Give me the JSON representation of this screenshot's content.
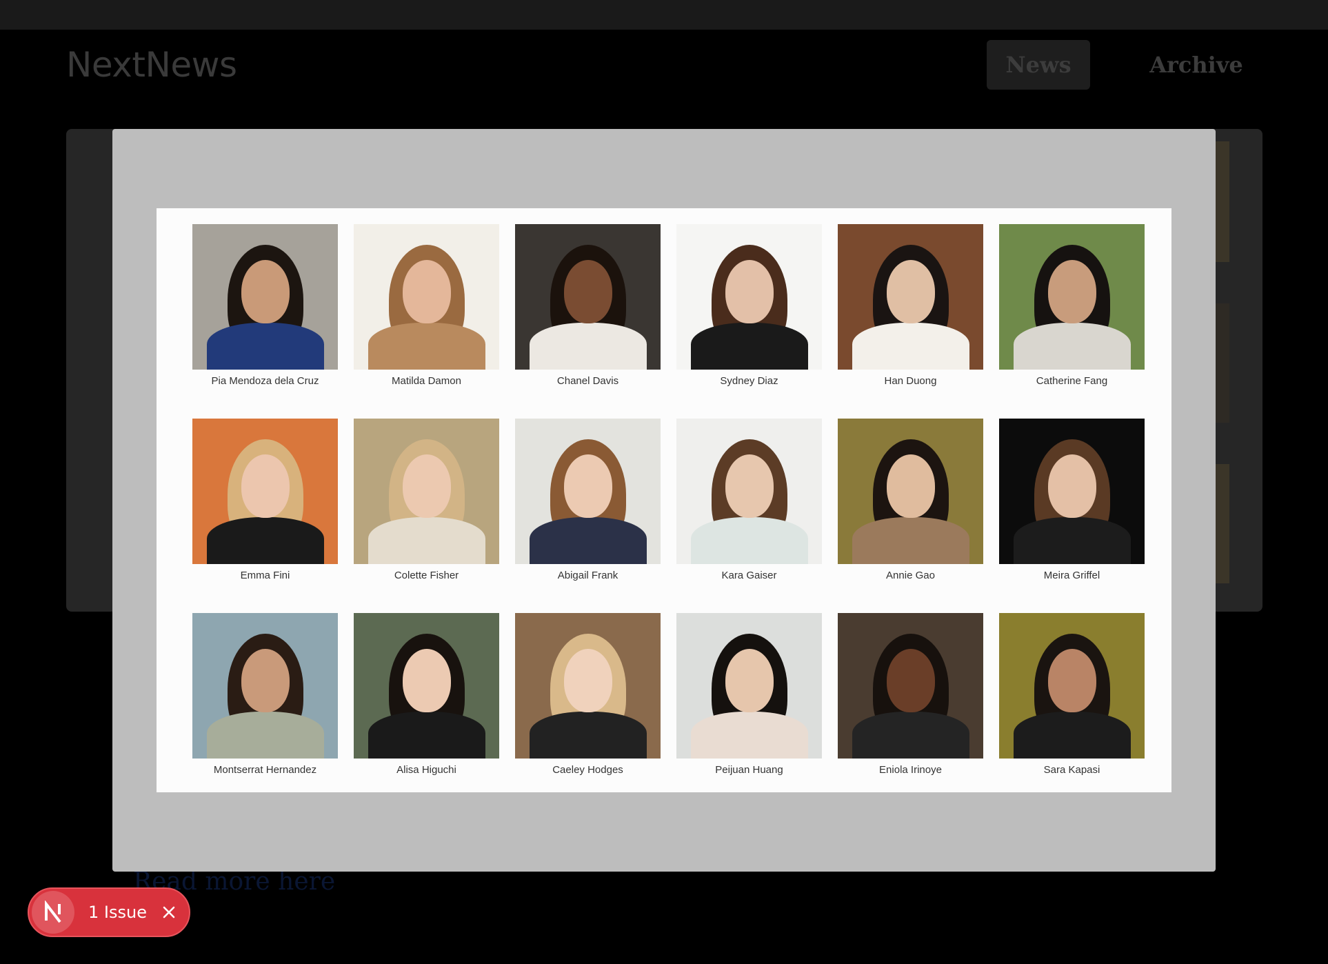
{
  "header": {
    "logo": "NextNews",
    "nav": [
      {
        "label": "News",
        "active": true
      },
      {
        "label": "Archive",
        "active": false
      }
    ]
  },
  "background": {
    "read_more_link": "Read more here"
  },
  "gallery": {
    "people": [
      {
        "name": "Pia Mendoza dela Cruz",
        "bg": "#a6a29a",
        "hair": "#1c1510",
        "skin": "#c99a78",
        "shirt": "#223a7a"
      },
      {
        "name": "Matilda Damon",
        "bg": "#f2efe8",
        "hair": "#9a6a40",
        "skin": "#e4b79a",
        "shirt": "#b98a5e"
      },
      {
        "name": "Chanel Davis",
        "bg": "#3a3632",
        "hair": "#1b120c",
        "skin": "#7a4c32",
        "shirt": "#ece8e2"
      },
      {
        "name": "Sydney Diaz",
        "bg": "#f5f5f3",
        "hair": "#4a2c1c",
        "skin": "#e3c0a8",
        "shirt": "#1a1a1a"
      },
      {
        "name": "Han Duong",
        "bg": "#7a4a2e",
        "hair": "#1a1412",
        "skin": "#e0bfa4",
        "shirt": "#f3f0ea"
      },
      {
        "name": "Catherine Fang",
        "bg": "#6f8a4a",
        "hair": "#161210",
        "skin": "#c89c7c",
        "shirt": "#d9d6cf"
      },
      {
        "name": "Emma Fini",
        "bg": "#d9773c",
        "hair": "#d8b27c",
        "skin": "#ecc6ae",
        "shirt": "#1a1a1a"
      },
      {
        "name": "Colette Fisher",
        "bg": "#b8a57e",
        "hair": "#d2b486",
        "skin": "#ecc9b0",
        "shirt": "#e4dccd"
      },
      {
        "name": "Abigail Frank",
        "bg": "#e3e3de",
        "hair": "#8a5a34",
        "skin": "#eccab2",
        "shirt": "#2b3148"
      },
      {
        "name": "Kara Gaiser",
        "bg": "#efefed",
        "hair": "#5c3c26",
        "skin": "#e7c7ae",
        "shirt": "#dde5e2"
      },
      {
        "name": "Annie Gao",
        "bg": "#8a7a3a",
        "hair": "#1c1410",
        "skin": "#e0bc9e",
        "shirt": "#9b7a5c"
      },
      {
        "name": "Meira Griffel",
        "bg": "#0c0c0c",
        "hair": "#5a3a24",
        "skin": "#e4c0a6",
        "shirt": "#1c1c1c"
      },
      {
        "name": "Montserrat Hernandez",
        "bg": "#8ea6b0",
        "hair": "#2a1c14",
        "skin": "#c99a7a",
        "shirt": "#a7ad9a"
      },
      {
        "name": "Alisa Higuchi",
        "bg": "#5c6a52",
        "hair": "#18120e",
        "skin": "#eccab2",
        "shirt": "#1a1a1a"
      },
      {
        "name": "Caeley Hodges",
        "bg": "#8a6a4c",
        "hair": "#d9b98a",
        "skin": "#f0d2bc",
        "shirt": "#222222"
      },
      {
        "name": "Peijuan Huang",
        "bg": "#dcdedc",
        "hair": "#15110e",
        "skin": "#e6c6ac",
        "shirt": "#e9dcd2"
      },
      {
        "name": "Eniola Irinoye",
        "bg": "#4a3c30",
        "hair": "#17110d",
        "skin": "#6a3e28",
        "shirt": "#242424"
      },
      {
        "name": "Sara Kapasi",
        "bg": "#8a7e2e",
        "hair": "#1a1410",
        "skin": "#b98466",
        "shirt": "#1c1c1c"
      }
    ]
  },
  "issue_badge": {
    "letter": "N",
    "label": "1 Issue"
  }
}
